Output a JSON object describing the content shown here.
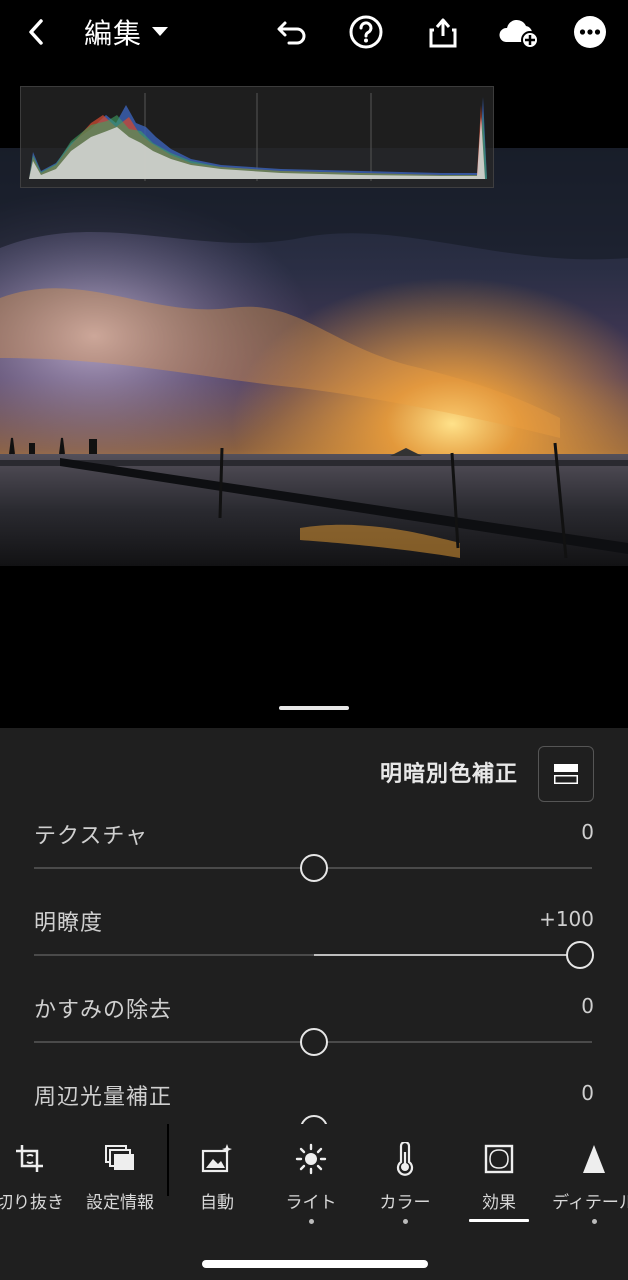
{
  "header": {
    "title": "編集",
    "icons": [
      "back-icon",
      "dropdown-icon",
      "undo-icon",
      "help-icon",
      "share-icon",
      "cloud-add-icon",
      "more-icon"
    ]
  },
  "panel": {
    "title": "明暗別色補正",
    "sliders": [
      {
        "label": "テクスチャ",
        "value": "0",
        "position": 0.5
      },
      {
        "label": "明瞭度",
        "value": "+100",
        "position": 1.0
      },
      {
        "label": "かすみの除去",
        "value": "0",
        "position": 0.5
      },
      {
        "label": "周辺光量補正",
        "value": "0",
        "position": 0.5
      }
    ]
  },
  "toolbar": {
    "items": [
      {
        "label": "切り抜き",
        "icon": "crop-icon"
      },
      {
        "label": "設定情報",
        "icon": "presets-icon"
      },
      {
        "label": "自動",
        "icon": "auto-icon"
      },
      {
        "label": "ライト",
        "icon": "light-icon"
      },
      {
        "label": "カラー",
        "icon": "color-icon"
      },
      {
        "label": "効果",
        "icon": "effects-icon",
        "active": true
      },
      {
        "label": "ディテール",
        "icon": "detail-icon"
      }
    ]
  },
  "colors": {
    "panel_bg": "#1f1f1f",
    "accent": "#ffffff",
    "slider_track": "#4a4a4a",
    "slider_fill": "#bdbdbd"
  }
}
